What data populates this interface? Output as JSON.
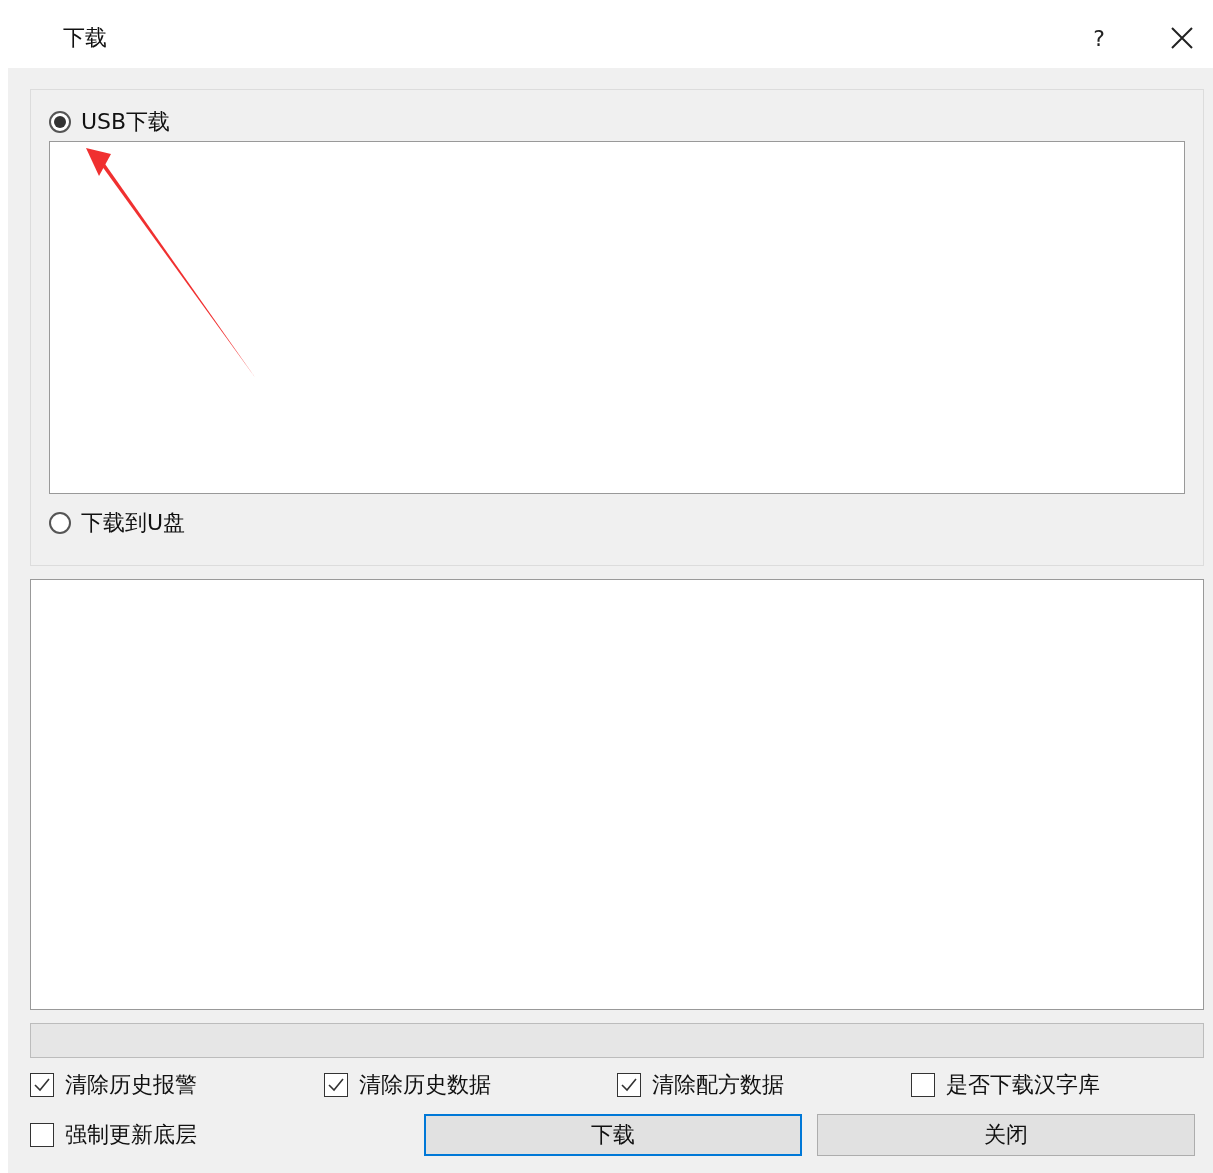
{
  "window": {
    "title": "下载",
    "help_glyph": "?"
  },
  "source_options": [
    {
      "label": "USB下载",
      "selected": true
    },
    {
      "label": "下载到U盘",
      "selected": false
    }
  ],
  "options": [
    {
      "label": "清除历史报警",
      "checked": true
    },
    {
      "label": "清除历史数据",
      "checked": true
    },
    {
      "label": "清除配方数据",
      "checked": true
    },
    {
      "label": "是否下载汉字库",
      "checked": false
    },
    {
      "label": "强制更新底层",
      "checked": false
    }
  ],
  "buttons": [
    {
      "label": "下载",
      "default": true
    },
    {
      "label": "关闭",
      "default": false
    }
  ]
}
